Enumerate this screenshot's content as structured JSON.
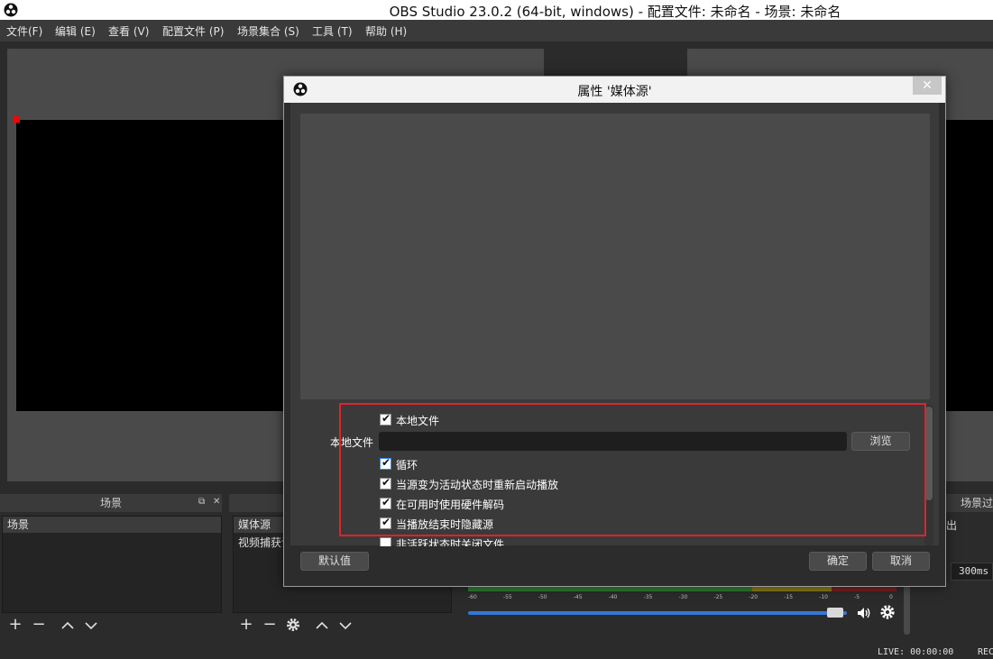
{
  "window": {
    "title": "OBS Studio 23.0.2 (64-bit, windows) - 配置文件: 未命名 - 场景: 未命名",
    "app_icon": "obs-logo-icon"
  },
  "menu": {
    "items": [
      "文件(F)",
      "编辑 (E)",
      "查看 (V)",
      "配置文件 (P)",
      "场景集合 (S)",
      "工具 (T)",
      "帮助 (H)"
    ]
  },
  "scenes_dock": {
    "title": "场景",
    "items": [
      "场景"
    ],
    "toolbar": [
      "plus-icon",
      "minus-icon",
      "chevron-up-icon",
      "chevron-down-icon"
    ]
  },
  "sources_dock": {
    "items": [
      "媒体源",
      "视频捕获设"
    ],
    "toolbar": [
      "plus-icon",
      "minus-icon",
      "gear-icon",
      "chevron-up-icon",
      "chevron-down-icon"
    ]
  },
  "mixer": {
    "ticks": [
      "-60",
      "-55",
      "-50",
      "-45",
      "-40",
      "-35",
      "-30",
      "-25",
      "-20",
      "-15",
      "-10",
      "-5",
      "0"
    ],
    "volume_fraction": 0.98,
    "colors": {
      "green": "#4caf50",
      "yellow": "#c8b420",
      "red": "#b22a2a",
      "slider": "#3477d8"
    }
  },
  "transitions_dock": {
    "title": "场景过",
    "text": "出",
    "duration": "300ms"
  },
  "status": {
    "live": "LIVE: 00:00:00",
    "rec": "REC"
  },
  "dialog": {
    "title": "属性 '媒体源'",
    "close_glyph": "✕",
    "local_file_checkbox": {
      "label": "本地文件",
      "checked": true
    },
    "file_field": {
      "label": "本地文件",
      "value": ""
    },
    "browse_label": "浏览",
    "checkboxes": [
      {
        "label": "循环",
        "checked": true
      },
      {
        "label": "当源变为活动状态时重新启动播放",
        "checked": true
      },
      {
        "label": "在可用时使用硬件解码",
        "checked": true
      },
      {
        "label": "当播放结束时隐藏源",
        "checked": true
      },
      {
        "label": "非活跃状态时关闭文件",
        "checked": false
      }
    ],
    "defaults_label": "默认值",
    "ok_label": "确定",
    "cancel_label": "取消",
    "highlight_color": "#e0222b"
  }
}
